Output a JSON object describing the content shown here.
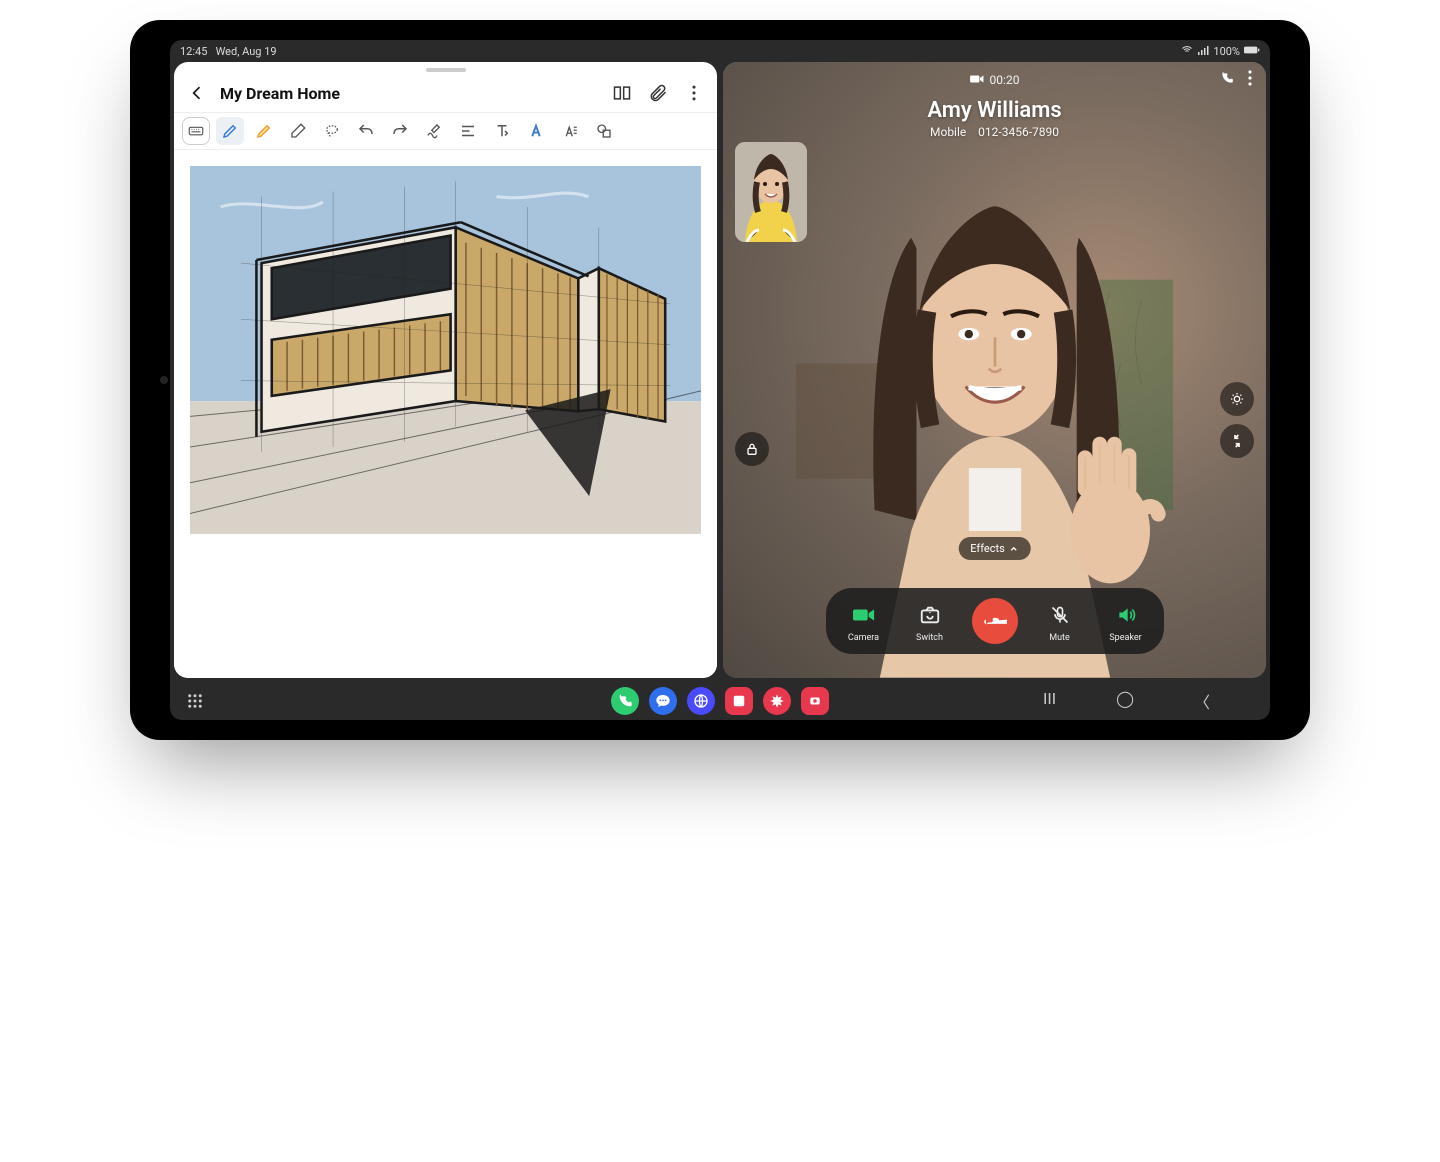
{
  "statusbar": {
    "time": "12:45",
    "date": "Wed, Aug 19",
    "battery": "100%"
  },
  "notes": {
    "title": "My Dream Home",
    "header_icons": {
      "reader": "reader-icon",
      "attach": "attach-icon",
      "more": "more-icon"
    },
    "tools": [
      "keyboard",
      "pen",
      "highlighter",
      "eraser",
      "lasso",
      "undo",
      "redo",
      "handwriting",
      "align",
      "text-insert",
      "font-style",
      "text-options",
      "shape"
    ]
  },
  "call": {
    "duration": "00:20",
    "name": "Amy Williams",
    "sub_label": "Mobile",
    "sub_number": "012-3456-7890",
    "effects_label": "Effects",
    "controls": {
      "camera": "Camera",
      "switch": "Switch",
      "mute": "Mute",
      "speaker": "Speaker"
    }
  },
  "taskbar": {
    "apps": [
      "phone",
      "messages",
      "browser",
      "app1",
      "app2",
      "app3"
    ]
  }
}
